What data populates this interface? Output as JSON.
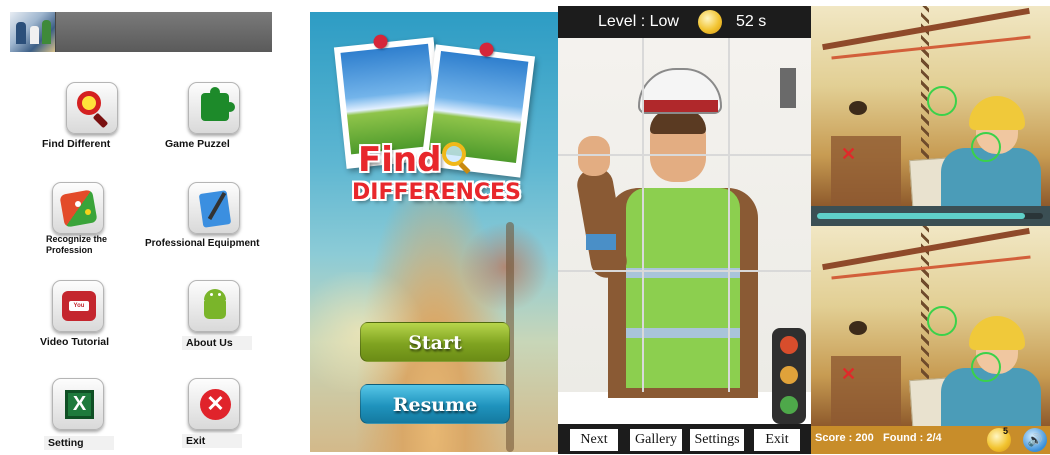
{
  "menu": {
    "items": [
      {
        "label": "Find Different",
        "icon": "search-icon"
      },
      {
        "label": "Game Puzzel",
        "icon": "puzzle-icon"
      },
      {
        "label": "Recognize the Profession",
        "icon": "dice-icon"
      },
      {
        "label": "Professional Equipment",
        "icon": "notepad-icon"
      },
      {
        "label": "Video Tutorial",
        "icon": "youtube-icon"
      },
      {
        "label": "About Us",
        "icon": "android-icon"
      },
      {
        "label": "Setting",
        "icon": "excel-icon"
      },
      {
        "label": "Exit",
        "icon": "close-icon"
      }
    ],
    "youtube_text": "You Tube"
  },
  "title_screen": {
    "title_line1": "Find",
    "title_line2": "DIFFERENCES",
    "start_label": "Start",
    "resume_label": "Resume"
  },
  "puzzle": {
    "level_text": "Level : Low",
    "time_text": "52 s",
    "nav": [
      "Next",
      "Gallery",
      "Settings",
      "Exit"
    ]
  },
  "spot": {
    "score_text": "Score : 200",
    "found_text": "Found : 2/4",
    "hint_count": "5",
    "progress_fraction": 0.92,
    "accent_color": "#3ad24a"
  }
}
